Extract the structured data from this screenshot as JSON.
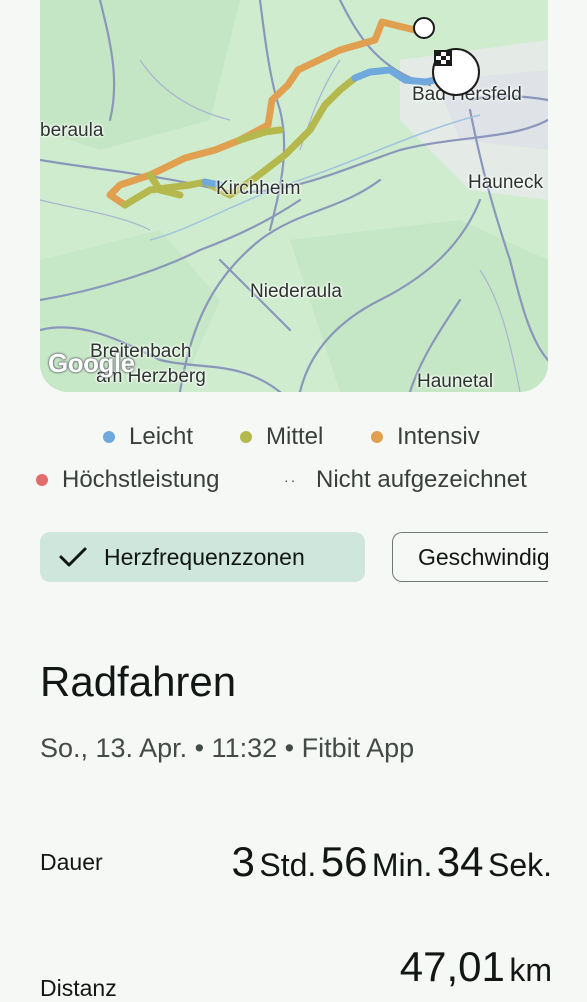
{
  "map": {
    "places": {
      "bad_hersfeld": "Bad Hersfeld",
      "oberaula": "beraula",
      "hauneck": "Hauneck",
      "kirchheim": "Kirchheim",
      "niederaula": "Niederaula",
      "breitenbach": "Breitenbach",
      "am_herzberg": "am Herzberg",
      "haunetal": "Haunetal"
    },
    "attribution": "Google",
    "start_marker": "start-circle-icon",
    "finish_marker": "checkered-flag-icon"
  },
  "legend": [
    {
      "label": "Leicht",
      "color": "#6fa8dc"
    },
    {
      "label": "Mittel",
      "color": "#b5b84d"
    },
    {
      "label": "Intensiv",
      "color": "#e0a04f"
    },
    {
      "label": "Höchstleistung",
      "color": "#e06c6c"
    },
    {
      "label": "Nicht aufgezeichnet",
      "icon": "dotted-line-icon"
    }
  ],
  "chips": {
    "heart_rate": "Herzfrequenzzonen",
    "speed": "Geschwindigkeit"
  },
  "activity": {
    "title": "Radfahren",
    "subtitle": "So., 13. Apr. • 11:32 • Fitbit App"
  },
  "stats": {
    "duration": {
      "label": "Dauer",
      "hours": "3",
      "hours_unit": "Std.",
      "minutes": "56",
      "minutes_unit": "Min.",
      "seconds": "34",
      "seconds_unit": "Sek."
    },
    "distance": {
      "label": "Distanz",
      "value": "47,01",
      "unit": "km"
    }
  },
  "colors": {
    "map_background": "#cfeccf",
    "road": "#8a97bb",
    "chip_active": "#cfe6dd"
  }
}
